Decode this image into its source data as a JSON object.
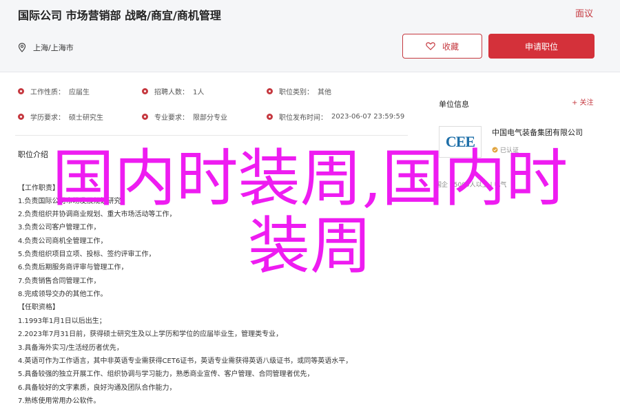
{
  "header": {
    "title": "国际公司 市场营销部 战略/商宜/商机管理",
    "report": "面议",
    "location": "上海/上海市",
    "fav_label": "收藏",
    "apply_label": "申请职位"
  },
  "job_info": [
    {
      "label": "工作性质：",
      "value": "应届生"
    },
    {
      "label": "招聘人数：",
      "value": "1人"
    },
    {
      "label": "职位类别：",
      "value": "其他"
    },
    {
      "label": "学历要求：",
      "value": "硕士研究生"
    },
    {
      "label": "专业要求：",
      "value": "限部分专业"
    },
    {
      "label": "职位发布时间：",
      "value": "2023-06-07 23:59:59"
    }
  ],
  "description": {
    "heading": "职位介绍",
    "lines": [
      "【工作职责】",
      "1.负责国际公司市场发展规划研究，",
      "2.负责组织并协调商业规划、重大市场活动等工作，",
      "3.负责公司客户管理工作，",
      "4.负责公司商机全管理工作，",
      "5.负责组织项目立项、投标、签约评审工作，",
      "6.负责后期服务商评审与管理工作，",
      "7.负责销售合同管理工作，",
      "8.完成领导交办的其他工作。",
      "【任职资格】",
      "1.1993年1月1日以后出生；",
      "2.2023年7月31日前，获得硕士研究生及以上学历和学位的应届毕业生，管理类专业，",
      "3.具备海外实习/生活经历者优先，",
      "4.英语可作为工作语言，其中非英语专业需获得CET6证书，英语专业需获得英语八级证书，或同等英语水平，",
      "5.具备较强的独立开展工作、组织协调与学习能力，熟悉商业宣传、客户管理、合同管理者优先，",
      "6.具备较好的文字素质，良好沟通及团队合作能力，",
      "7.熟练使用常用办公软件。"
    ]
  },
  "sidebar": {
    "title": "单位信息",
    "follow": "+ 关注",
    "logo_text": "CEE",
    "company": "中国电气装备集团有限公司",
    "certified": "已认证",
    "tags": "国企 | 5000人以上 | 电气"
  },
  "overlay": {
    "line1": "国内时装周,国内时",
    "line2": "装周"
  },
  "colors": {
    "accent": "#d4313a",
    "overlay": "#ee1cf1"
  }
}
